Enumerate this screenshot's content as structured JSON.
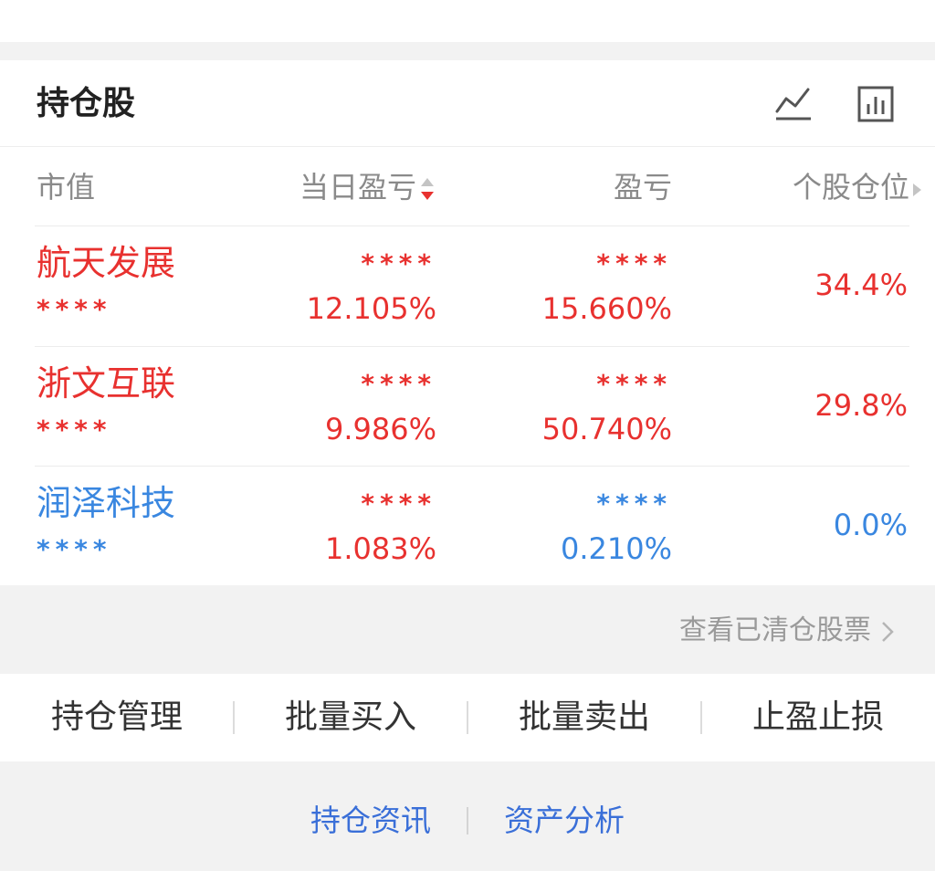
{
  "header": {
    "title": "持仓股",
    "icons": [
      "line-chart-icon",
      "bar-chart-icon"
    ]
  },
  "columns": {
    "market_value": "市值",
    "daily_pnl": "当日盈亏",
    "pnl": "盈亏",
    "position_ratio": "个股仓位"
  },
  "colors": {
    "up": "#e8312f",
    "flat": "#3a87e0",
    "link": "#3a6fd8"
  },
  "rows": [
    {
      "name": "航天发展",
      "value_mask": "****",
      "daily_mask": "****",
      "daily_pct": "12.105%",
      "pnl_mask": "****",
      "pnl_pct": "15.660%",
      "position": "34.4%"
    },
    {
      "name": "浙文互联",
      "value_mask": "****",
      "daily_mask": "****",
      "daily_pct": "9.986%",
      "pnl_mask": "****",
      "pnl_pct": "50.740%",
      "position": "29.8%"
    },
    {
      "name": "润泽科技",
      "value_mask": "****",
      "daily_mask": "****",
      "daily_pct": "1.083%",
      "pnl_mask": "****",
      "pnl_pct": "0.210%",
      "position": "0.0%"
    }
  ],
  "view_cleared": "查看已清仓股票",
  "actions": [
    "持仓管理",
    "批量买入",
    "批量卖出",
    "止盈止损"
  ],
  "bottom_links": [
    "持仓资讯",
    "资产分析"
  ]
}
